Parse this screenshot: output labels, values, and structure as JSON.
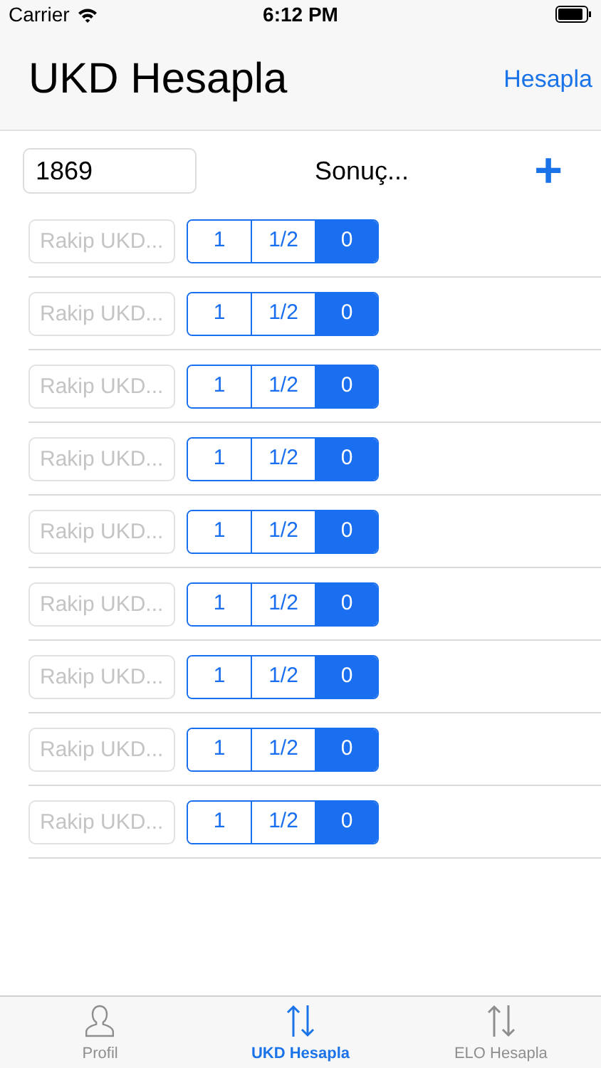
{
  "status_bar": {
    "carrier": "Carrier",
    "time": "6:12 PM"
  },
  "nav_bar": {
    "title": "UKD Hesapla",
    "action": "Hesapla"
  },
  "header": {
    "rating_value": "1869",
    "result": "Sonuç...",
    "add": "+"
  },
  "rows": [
    {
      "placeholder": "Rakip UKD...",
      "options": [
        {
          "label": "1",
          "selected": false
        },
        {
          "label": "1/2",
          "selected": false
        },
        {
          "label": "0",
          "selected": true
        }
      ]
    },
    {
      "placeholder": "Rakip UKD...",
      "options": [
        {
          "label": "1",
          "selected": false
        },
        {
          "label": "1/2",
          "selected": false
        },
        {
          "label": "0",
          "selected": true
        }
      ]
    },
    {
      "placeholder": "Rakip UKD...",
      "options": [
        {
          "label": "1",
          "selected": false
        },
        {
          "label": "1/2",
          "selected": false
        },
        {
          "label": "0",
          "selected": true
        }
      ]
    },
    {
      "placeholder": "Rakip UKD...",
      "options": [
        {
          "label": "1",
          "selected": false
        },
        {
          "label": "1/2",
          "selected": false
        },
        {
          "label": "0",
          "selected": true
        }
      ]
    },
    {
      "placeholder": "Rakip UKD...",
      "options": [
        {
          "label": "1",
          "selected": false
        },
        {
          "label": "1/2",
          "selected": false
        },
        {
          "label": "0",
          "selected": true
        }
      ]
    },
    {
      "placeholder": "Rakip UKD...",
      "options": [
        {
          "label": "1",
          "selected": false
        },
        {
          "label": "1/2",
          "selected": false
        },
        {
          "label": "0",
          "selected": true
        }
      ]
    },
    {
      "placeholder": "Rakip UKD...",
      "options": [
        {
          "label": "1",
          "selected": false
        },
        {
          "label": "1/2",
          "selected": false
        },
        {
          "label": "0",
          "selected": true
        }
      ]
    },
    {
      "placeholder": "Rakip UKD...",
      "options": [
        {
          "label": "1",
          "selected": false
        },
        {
          "label": "1/2",
          "selected": false
        },
        {
          "label": "0",
          "selected": true
        }
      ]
    },
    {
      "placeholder": "Rakip UKD...",
      "options": [
        {
          "label": "1",
          "selected": false
        },
        {
          "label": "1/2",
          "selected": false
        },
        {
          "label": "0",
          "selected": true
        }
      ]
    }
  ],
  "tab_bar": [
    {
      "kind": "person",
      "label": "Profil",
      "selected": false
    },
    {
      "kind": "arrows",
      "label": "UKD Hesapla",
      "selected": true
    },
    {
      "kind": "arrows",
      "label": "ELO Hesapla",
      "selected": false
    }
  ]
}
